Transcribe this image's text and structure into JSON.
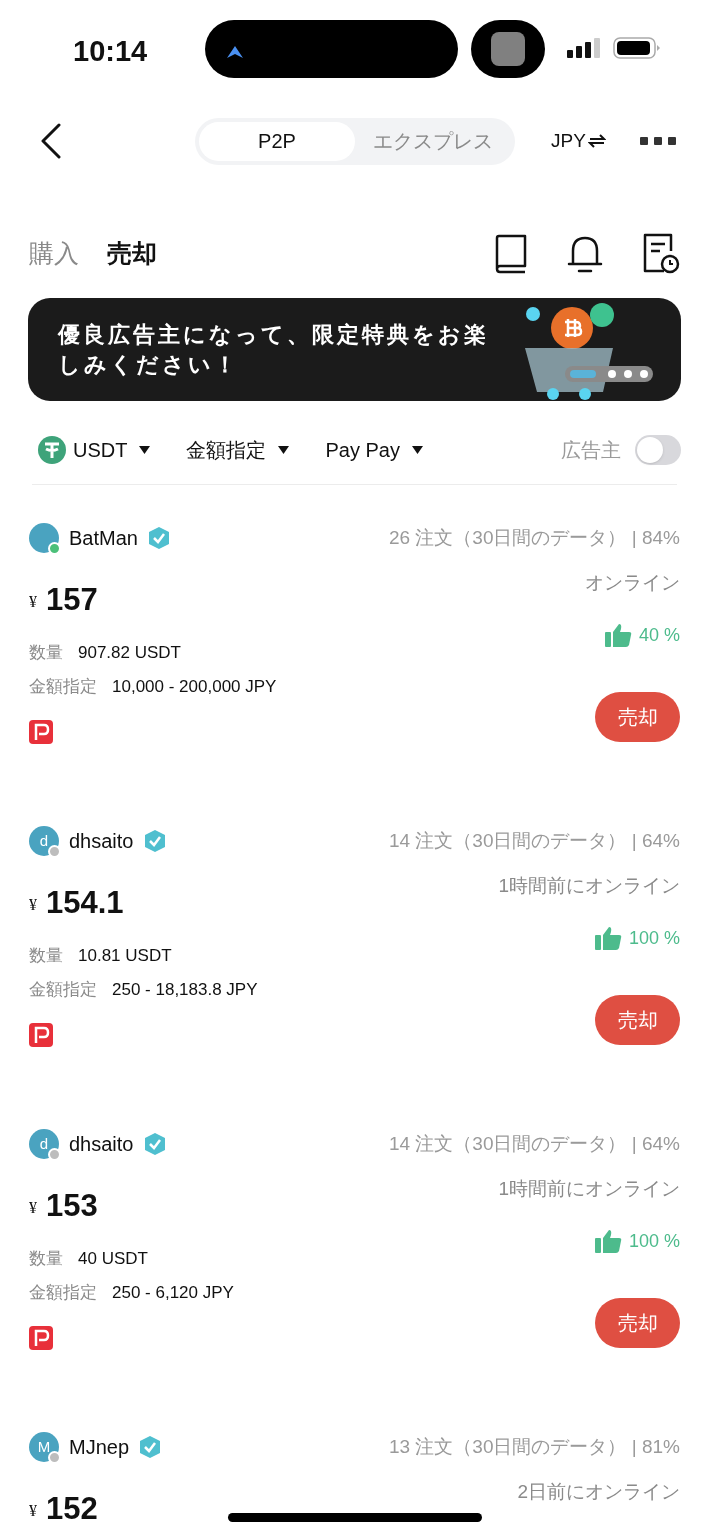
{
  "status_bar": {
    "time": "10:14"
  },
  "nav": {
    "segments": [
      {
        "label": "P2P",
        "selected": true
      },
      {
        "label": "エクスプレス",
        "selected": false
      }
    ],
    "currency": "JPY"
  },
  "trade_tabs": [
    {
      "label": "購入",
      "selected": false
    },
    {
      "label": "売却",
      "selected": true
    }
  ],
  "banner": {
    "text": "優良広告主になって、限定特典をお楽しみください！"
  },
  "filters": [
    {
      "label": "USDT",
      "kind": "coin"
    },
    {
      "label": "金額指定",
      "kind": "plain"
    },
    {
      "label": "Pay Pay",
      "kind": "plain"
    }
  ],
  "advertiser_toggle": {
    "label": "広告主",
    "on": false
  },
  "listings": [
    {
      "name": "BatMan",
      "online": true,
      "stats": "26 注文（30日間のデータ） | 84%",
      "currency": "¥",
      "price": "157",
      "status": "オンライン",
      "rating": "40 %",
      "quantity_label": "数量",
      "quantity": "907.82 USDT",
      "limit_label": "金額指定",
      "limit": "10,000 - 200,000 JPY",
      "button": "売却"
    },
    {
      "name": "dhsaito",
      "avatar_letter": "d",
      "online": false,
      "stats": "14 注文（30日間のデータ） | 64%",
      "currency": "¥",
      "price": "154.1",
      "status": "1時間前にオンライン",
      "rating": "100 %",
      "quantity_label": "数量",
      "quantity": "10.81 USDT",
      "limit_label": "金額指定",
      "limit": "250 - 18,183.8 JPY",
      "button": "売却"
    },
    {
      "name": "dhsaito",
      "avatar_letter": "d",
      "online": false,
      "stats": "14 注文（30日間のデータ） | 64%",
      "currency": "¥",
      "price": "153",
      "status": "1時間前にオンライン",
      "rating": "100 %",
      "quantity_label": "数量",
      "quantity": "40 USDT",
      "limit_label": "金額指定",
      "limit": "250 - 6,120 JPY",
      "button": "売却"
    },
    {
      "name": "MJnep",
      "avatar_letter": "M",
      "online": false,
      "stats": "13 注文（30日間のデータ） | 81%",
      "currency": "¥",
      "price": "152",
      "status": "2日前にオンライン"
    }
  ]
}
